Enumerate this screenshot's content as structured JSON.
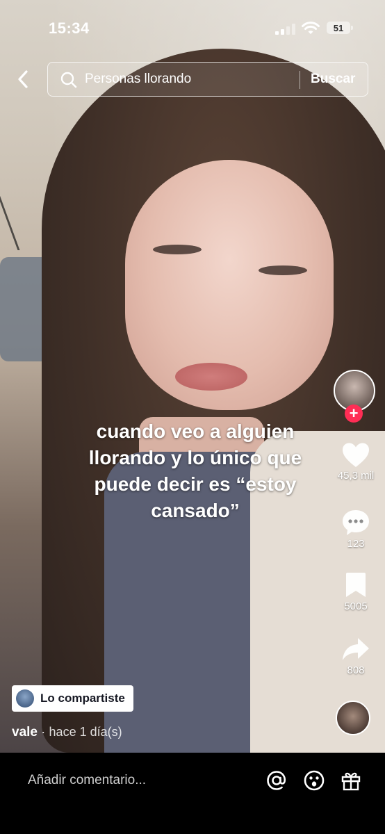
{
  "status_bar": {
    "time": "15:34",
    "battery": "51"
  },
  "search": {
    "query": "Personas llorando",
    "button": "Buscar"
  },
  "video": {
    "caption": "cuando veo a alguien llorando y lo único que puede decir es “estoy cansado”"
  },
  "actions": {
    "likes": "45,3 mil",
    "comments": "123",
    "saves": "5005",
    "shares": "808",
    "follow_symbol": "+"
  },
  "shared": {
    "label": "Lo compartiste"
  },
  "author": {
    "name": "vale",
    "separator": "·",
    "time": "hace 1 día(s)"
  },
  "comment_bar": {
    "placeholder": "Añadir comentario..."
  },
  "colors": {
    "follow": "#ff2d55",
    "background": "#000000"
  }
}
